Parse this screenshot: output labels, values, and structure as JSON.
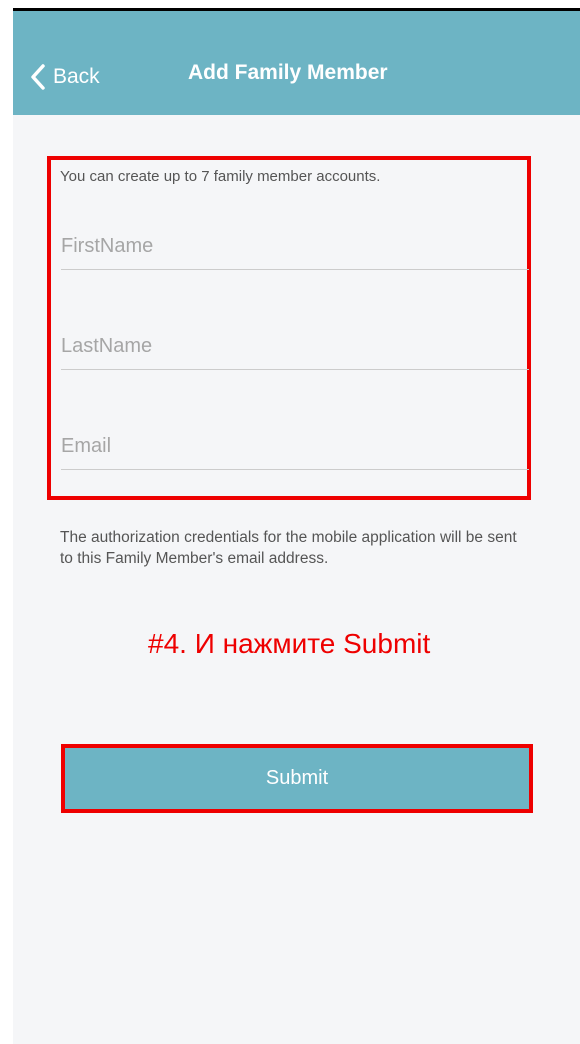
{
  "nav": {
    "back_label": "Back",
    "title": "Add Family Member"
  },
  "form": {
    "info": "You can create up to 7 family member accounts.",
    "fields": {
      "first_name_placeholder": "FirstName",
      "last_name_placeholder": "LastName",
      "email_placeholder": "Email"
    },
    "note": "The authorization credentials for the mobile application will be sent to this Family Member's email address."
  },
  "annotation": "#4. И нажмите Submit",
  "submit_label": "Submit",
  "colors": {
    "accent": "#6db4c4",
    "highlight": "#ee0000",
    "background": "#f5f6f8"
  },
  "icons": {
    "back": "chevron-left-icon"
  }
}
